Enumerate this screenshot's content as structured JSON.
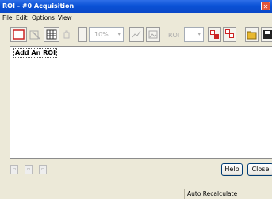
{
  "window": {
    "title": "ROI - #0  Acquisition"
  },
  "menu": [
    "File",
    "Edit",
    "Options",
    "View"
  ],
  "toolbar": {
    "zoom_value": "10%",
    "roi_label": "ROI"
  },
  "content": {
    "roi_item": "Add An ROI"
  },
  "buttons": {
    "help": "Help",
    "close": "Close"
  },
  "status": {
    "text": "Auto Recalculate"
  },
  "colors": {
    "titlebar": "#0a52d6",
    "accent_red": "#cc2222",
    "folder": "#e8b830"
  }
}
